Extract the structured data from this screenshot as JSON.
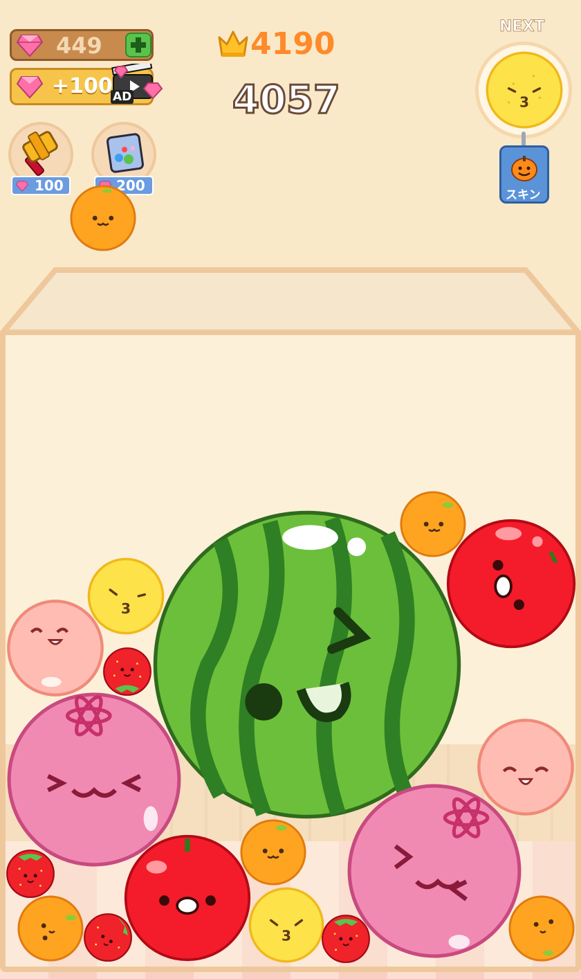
{
  "hud": {
    "gems_count": "449",
    "gems_plus_icon": "plus-icon",
    "ad_reward_label": "+100",
    "ad_badge": "AD",
    "best_score": "4190",
    "current_score": "4057",
    "next_label": "NEXT",
    "skin_label": "スキン"
  },
  "powerups": [
    {
      "name": "hammer",
      "cost": "100"
    },
    {
      "name": "shake-box",
      "cost": "200"
    }
  ],
  "next_fruit": "lemon",
  "held_fruit": "orange",
  "fruits_in_box": [
    "watermelon",
    "orange",
    "apple",
    "lemon",
    "peach",
    "strawberry",
    "pomegranate",
    "peach",
    "pomegranate",
    "orange",
    "strawberry",
    "apple",
    "orange",
    "strawberry",
    "lemon",
    "strawberry",
    "orange"
  ],
  "colors": {
    "background": "#f9e9c8",
    "score_orange": "#ff8a2a",
    "gem_pink": "#ff6fa8",
    "price_blue": "#6b9be0"
  }
}
